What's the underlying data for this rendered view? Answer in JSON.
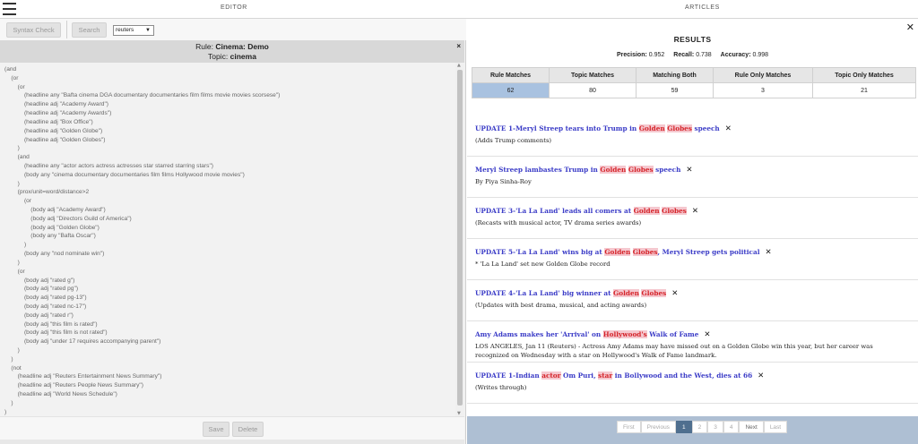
{
  "header": {
    "editor_title": "EDITOR",
    "articles_title": "ARTICLES"
  },
  "toolbar": {
    "syntax_check": "Syntax Check",
    "search": "Search",
    "source": "reuters"
  },
  "rule": {
    "label": "Rule:",
    "name": "Cinema: Demo",
    "topic_label": "Topic:",
    "topic": "cinema"
  },
  "code_lines": [
    "(and",
    "    (or",
    "        (or",
    "            (headline any \"Bafta cinema DGA documentary documentaries film films movie movies scorsese\")",
    "            (headline adj \"Academy Award\")",
    "            (headline adj \"Academy Awards\")",
    "            (headline adj \"Box Office\")",
    "            (headline adj \"Golden Globe\")",
    "            (headline adj \"Golden Globes\")",
    "        )",
    "        (and",
    "            (headline any \"actor actors actress actresses star starred starring stars\")",
    "            (body any \"cinema documentary documentaries film films Hollywood movie movies\")",
    "        )",
    "        (prox/unit=word/distance>2",
    "            (or",
    "                (body adj \"Academy Award\")",
    "                (body adj \"Directors Guild of America\")",
    "                (body adj \"Golden Globe\")",
    "                (body any \"Bafta Oscar\")",
    "            )",
    "            (body any \"nod nominate win\")",
    "        )",
    "        (or",
    "            (body adj \"rated g\")",
    "            (body adj \"rated pg\")",
    "            (body adj \"rated pg-13\")",
    "            (body adj \"rated nc-17\")",
    "            (body adj \"rated r\")",
    "            (body adj \"this film is rated\")",
    "            (body adj \"this film is not rated\")",
    "            (body adj \"under 17 requires accompanying parent\")",
    "        )",
    "    )",
    "    (not",
    "        (headline adj \"Reuters Entertainment News Summary\")",
    "        (headline adj \"Reuters People News Summary\")",
    "        (headline adj \"World News Schedule\")",
    "    )",
    ")"
  ],
  "footer": {
    "save": "Save",
    "delete": "Delete"
  },
  "results": {
    "title": "RESULTS",
    "precision_label": "Precision:",
    "precision": "0.952",
    "recall_label": "Recall:",
    "recall": "0.738",
    "accuracy_label": "Accuracy:",
    "accuracy": "0.998",
    "columns": [
      "Rule Matches",
      "Topic Matches",
      "Matching Both",
      "Rule Only Matches",
      "Topic Only Matches"
    ],
    "values": [
      "62",
      "80",
      "59",
      "3",
      "21"
    ]
  },
  "articles": [
    {
      "title": [
        [
          "UPDATE 1-Meryl Streep tears into Trump in ",
          false
        ],
        [
          "Golden",
          true
        ],
        [
          " ",
          false
        ],
        [
          "Globes",
          true
        ],
        [
          " speech",
          false
        ]
      ],
      "desc": "(Adds Trump comments)"
    },
    {
      "title": [
        [
          "Meryl Streep lambastes Trump in ",
          false
        ],
        [
          "Golden",
          true
        ],
        [
          " ",
          false
        ],
        [
          "Globes",
          true
        ],
        [
          " speech",
          false
        ]
      ],
      "desc": "By Piya Sinha-Roy"
    },
    {
      "title": [
        [
          "UPDATE 3-'La La Land' leads all comers at ",
          false
        ],
        [
          "Golden",
          true
        ],
        [
          " ",
          false
        ],
        [
          "Globes",
          true
        ]
      ],
      "desc": "(Recasts with musical actor, TV drama series awards)"
    },
    {
      "title": [
        [
          "UPDATE 5-'La La Land' wins big at ",
          false
        ],
        [
          "Golden",
          true
        ],
        [
          " ",
          false
        ],
        [
          "Globes",
          true
        ],
        [
          ", Meryl Streep gets political",
          false
        ]
      ],
      "desc": "* 'La La Land' set new Golden Globe record"
    },
    {
      "title": [
        [
          "UPDATE 4-'La La Land' big winner at ",
          false
        ],
        [
          "Golden",
          true
        ],
        [
          " ",
          false
        ],
        [
          "Globes",
          true
        ]
      ],
      "desc": "(Updates with best drama, musical, and acting awards)"
    },
    {
      "title": [
        [
          "Amy Adams makes her 'Arrival' on ",
          false
        ],
        [
          "Hollywood's",
          true
        ],
        [
          " Walk of Fame",
          false
        ]
      ],
      "desc": "LOS ANGELES, Jan 11 (Reuters) - Actress Amy Adams may have missed out on a Golden Globe win this year, but her career was recognized on Wednesday with a star on Hollywood's Walk of Fame landmark."
    },
    {
      "title": [
        [
          "UPDATE 1-Indian ",
          false
        ],
        [
          "actor",
          true
        ],
        [
          " Om Puri, ",
          false
        ],
        [
          "star",
          true
        ],
        [
          " in Bollywood and the West, dies at 66",
          false
        ]
      ],
      "desc": "(Writes through)"
    }
  ],
  "pager": {
    "first": "First",
    "previous": "Previous",
    "pages": [
      "1",
      "2",
      "3",
      "4"
    ],
    "current": "1",
    "next": "Next",
    "last": "Last"
  }
}
